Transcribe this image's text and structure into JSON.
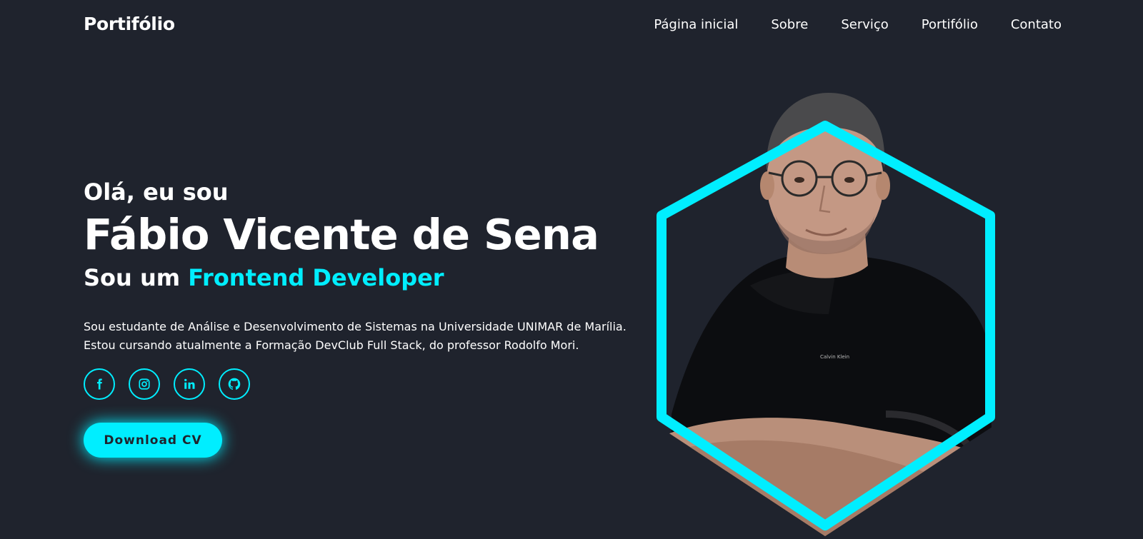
{
  "header": {
    "logo": "Portifólio",
    "nav": [
      "Página inicial",
      "Sobre",
      "Serviço",
      "Portifólio",
      "Contato"
    ]
  },
  "hero": {
    "greeting": "Olá, eu sou",
    "name": "Fábio Vicente de Sena",
    "role_prefix": "Sou um",
    "role_highlight": "Frontend Developer",
    "about": "Sou estudante de Análise e Desenvolvimento de Sistemas na Universidade UNIMAR de Marília. Estou cursando atualmente a Formação DevClub Full Stack, do professor Rodolfo Mori.",
    "socials": [
      "facebook-icon",
      "instagram-icon",
      "linkedin-icon",
      "github-icon"
    ],
    "cta": "Download CV",
    "shirt_logo": "Calvin Klein"
  },
  "colors": {
    "background": "#1f232d",
    "accent": "#00eeff",
    "text": "#ffffff"
  }
}
